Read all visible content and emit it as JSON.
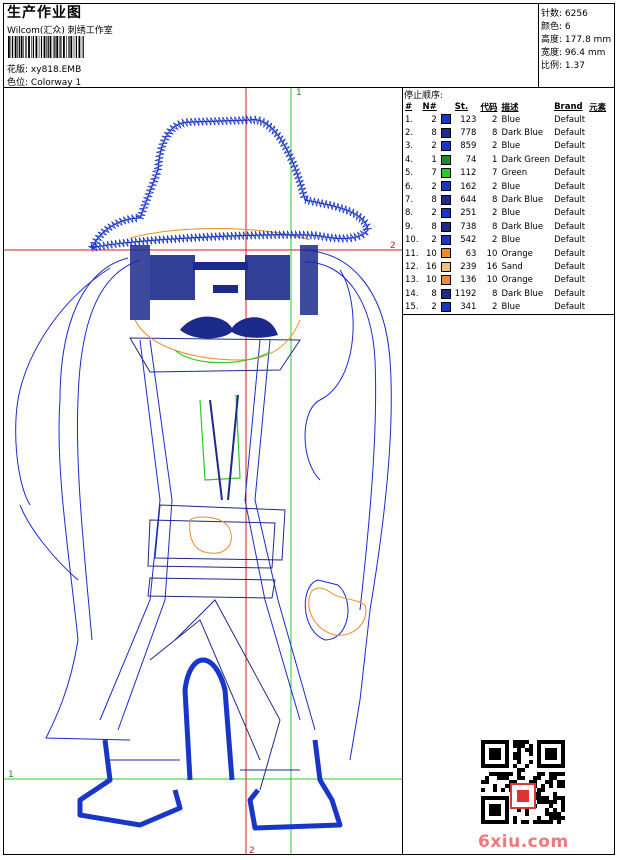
{
  "header": {
    "title": "生产作业图",
    "company": "Wilcom(汇众) 刺绣工作室",
    "design_label": "花版:",
    "design_file": "xy818.EMB",
    "colorway_label": "色位:",
    "colorway": "Colorway 1"
  },
  "meta": [
    {
      "label": "针数:",
      "value": "6256"
    },
    {
      "label": "颜色:",
      "value": "6"
    },
    {
      "label": "高度:",
      "value": "177.8 mm"
    },
    {
      "label": "宽度:",
      "value": "96.4 mm"
    },
    {
      "label": "比例:",
      "value": "1.37"
    }
  ],
  "stop_sequence_title": "停止顺序:",
  "table": {
    "headers": [
      "#",
      "N#",
      "",
      "St.",
      "代码",
      "描述",
      "Brand",
      "元素"
    ],
    "rows": [
      {
        "idx": "1.",
        "n": "2",
        "color": "#1a36c8",
        "st": "123",
        "code": "2",
        "desc": "Blue",
        "brand": "Default"
      },
      {
        "idx": "2.",
        "n": "8",
        "color": "#1c2a8c",
        "st": "778",
        "code": "8",
        "desc": "Dark Blue",
        "brand": "Default"
      },
      {
        "idx": "3.",
        "n": "2",
        "color": "#1a36c8",
        "st": "859",
        "code": "2",
        "desc": "Blue",
        "brand": "Default"
      },
      {
        "idx": "4.",
        "n": "1",
        "color": "#1f8a2e",
        "st": "74",
        "code": "1",
        "desc": "Dark Green",
        "brand": "Default"
      },
      {
        "idx": "5.",
        "n": "7",
        "color": "#2ec82e",
        "st": "112",
        "code": "7",
        "desc": "Green",
        "brand": "Default"
      },
      {
        "idx": "6.",
        "n": "2",
        "color": "#1a36c8",
        "st": "162",
        "code": "2",
        "desc": "Blue",
        "brand": "Default"
      },
      {
        "idx": "7.",
        "n": "8",
        "color": "#1c2a8c",
        "st": "644",
        "code": "8",
        "desc": "Dark Blue",
        "brand": "Default"
      },
      {
        "idx": "8.",
        "n": "2",
        "color": "#1a36c8",
        "st": "251",
        "code": "2",
        "desc": "Blue",
        "brand": "Default"
      },
      {
        "idx": "9.",
        "n": "8",
        "color": "#1c2a8c",
        "st": "738",
        "code": "8",
        "desc": "Dark Blue",
        "brand": "Default"
      },
      {
        "idx": "10.",
        "n": "2",
        "color": "#1a36c8",
        "st": "542",
        "code": "2",
        "desc": "Blue",
        "brand": "Default"
      },
      {
        "idx": "11.",
        "n": "10",
        "color": "#f08a2a",
        "st": "63",
        "code": "10",
        "desc": "Orange",
        "brand": "Default"
      },
      {
        "idx": "12.",
        "n": "16",
        "color": "#f2c07a",
        "st": "239",
        "code": "16",
        "desc": "Sand",
        "brand": "Default"
      },
      {
        "idx": "13.",
        "n": "10",
        "color": "#f08a2a",
        "st": "136",
        "code": "10",
        "desc": "Orange",
        "brand": "Default"
      },
      {
        "idx": "14.",
        "n": "8",
        "color": "#1c2a8c",
        "st": "1192",
        "code": "8",
        "desc": "Dark Blue",
        "brand": "Default"
      },
      {
        "idx": "15.",
        "n": "2",
        "color": "#1a36c8",
        "st": "341",
        "code": "2",
        "desc": "Blue",
        "brand": "Default"
      }
    ]
  },
  "axis_labels": {
    "top": "1",
    "right": "2",
    "left": "1",
    "bottom": "2"
  },
  "watermark": "6xiu.com",
  "colors": {
    "guide_green": "#2ec82e",
    "guide_red": "#d81b1b",
    "outline_blue": "#1a2ad0",
    "dark_blue": "#1c2a8c",
    "orange": "#f08a2a"
  }
}
